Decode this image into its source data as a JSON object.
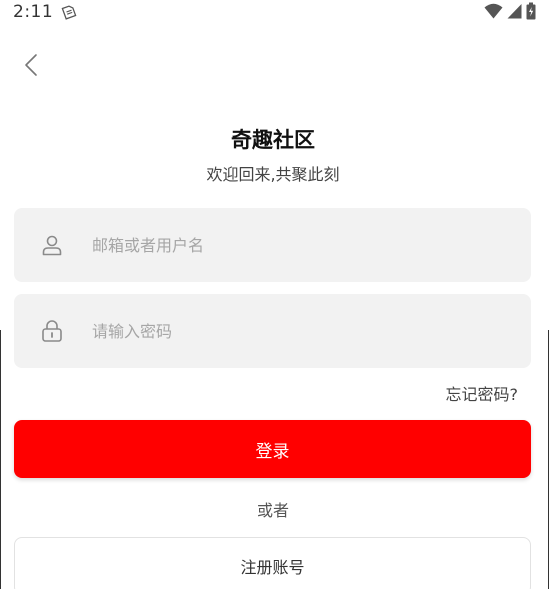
{
  "status_bar": {
    "time": "2:11",
    "icons": [
      "sim-card-icon",
      "wifi-icon",
      "signal-icon",
      "battery-icon"
    ]
  },
  "header": {
    "back_icon": "chevron-left-icon",
    "title": "奇趣社区",
    "subtitle": "欢迎回来,共聚此刻"
  },
  "form": {
    "username": {
      "icon": "user-icon",
      "value": "",
      "placeholder": "邮箱或者用户名"
    },
    "password": {
      "icon": "lock-icon",
      "value": "",
      "placeholder": "请输入密码"
    },
    "forgot_label": "忘记密码?",
    "login_label": "登录",
    "or_label": "或者",
    "register_label": "注册账号"
  },
  "colors": {
    "accent": "#ff0000",
    "field_bg": "#f2f2f2",
    "placeholder": "#a6a6a6"
  }
}
